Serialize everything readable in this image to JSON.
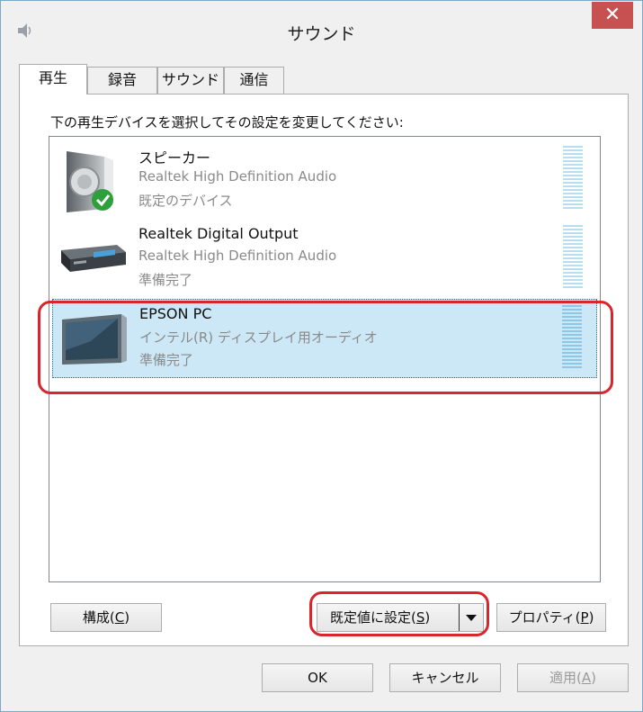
{
  "window": {
    "title": "サウンド",
    "close_glyph": "✕"
  },
  "tabs": [
    {
      "label": "再生",
      "active": true
    },
    {
      "label": "録音",
      "active": false
    },
    {
      "label": "サウンド",
      "active": false
    },
    {
      "label": "通信",
      "active": false
    }
  ],
  "instruction": "下の再生デバイスを選択してその設定を変更してください:",
  "devices": [
    {
      "name": "スピーカー",
      "driver": "Realtek High Definition Audio",
      "status": "既定のデバイス",
      "icon": "speaker-icon",
      "default": true,
      "selected": false
    },
    {
      "name": "Realtek Digital Output",
      "driver": "Realtek High Definition Audio",
      "status": "準備完了",
      "icon": "digital-output-icon",
      "default": false,
      "selected": false
    },
    {
      "name": "EPSON PC",
      "driver": "インテル(R) ディスプレイ用オーディオ",
      "status": "準備完了",
      "icon": "monitor-icon",
      "default": false,
      "selected": true
    }
  ],
  "buttons": {
    "configure": {
      "label": "構成(",
      "key": "C",
      "suffix": ")"
    },
    "set_default": {
      "label": "既定値に設定(",
      "key": "S",
      "suffix": ")"
    },
    "properties": {
      "label": "プロパティ(",
      "key": "P",
      "suffix": ")"
    },
    "ok": "OK",
    "cancel": "キャンセル",
    "apply": {
      "label": "適用(",
      "key": "A",
      "suffix": ")"
    }
  },
  "colors": {
    "selection": "#cce8f6",
    "close": "#c75050",
    "highlight": "#d9262c"
  }
}
